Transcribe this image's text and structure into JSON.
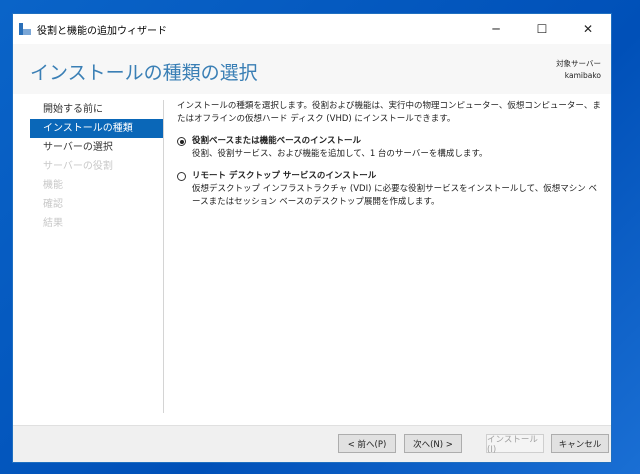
{
  "window": {
    "title": "役割と機能の追加ウィザード",
    "minimize": "─",
    "maximize": "☐",
    "close": "✕"
  },
  "header": {
    "title": "インストールの種類の選択",
    "server_label": "対象サーバー",
    "server_name": "kamibako"
  },
  "nav": {
    "items": [
      {
        "label": "開始する前に",
        "state": "normal"
      },
      {
        "label": "インストールの種類",
        "state": "selected"
      },
      {
        "label": "サーバーの選択",
        "state": "normal"
      },
      {
        "label": "サーバーの役割",
        "state": "disabled"
      },
      {
        "label": "機能",
        "state": "disabled"
      },
      {
        "label": "確認",
        "state": "disabled"
      },
      {
        "label": "結果",
        "state": "disabled"
      }
    ]
  },
  "content": {
    "intro": "インストールの種類を選択します。役割および機能は、実行中の物理コンピューター、仮想コンピューター、またはオフラインの仮想ハード ディスク (VHD) にインストールできます。",
    "options": [
      {
        "label": "役割ベースまたは機能ベースのインストール",
        "desc": "役割、役割サービス、および機能を追加して、1 台のサーバーを構成します。",
        "selected": true
      },
      {
        "label": "リモート デスクトップ サービスのインストール",
        "desc": "仮想デスクトップ インフラストラクチャ (VDI) に必要な役割サービスをインストールして、仮想マシン ベースまたはセッション ベースのデスクトップ展開を作成します。",
        "selected": false
      }
    ]
  },
  "footer": {
    "prev": "< 前へ(P)",
    "next": "次へ(N) >",
    "install": "インストール(I)",
    "cancel": "キャンセル"
  }
}
